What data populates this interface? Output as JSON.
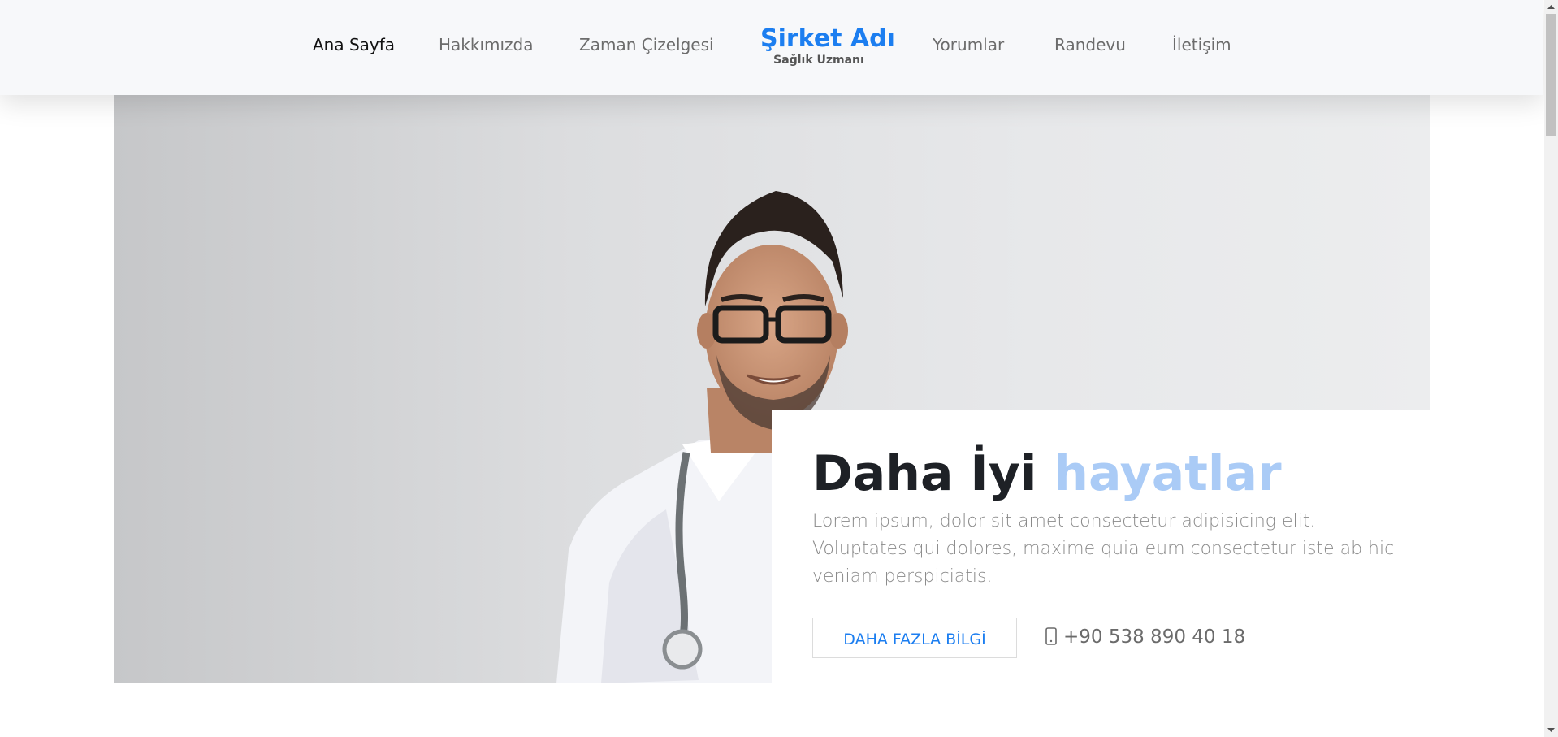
{
  "nav": {
    "items": [
      {
        "label": "Ana Sayfa"
      },
      {
        "label": "Hakkımızda"
      },
      {
        "label": "Zaman Çizelgesi"
      },
      {
        "label": "Yorumlar"
      },
      {
        "label": "Randevu"
      },
      {
        "label": "İletişim"
      }
    ],
    "brand": {
      "title": "Şirket Adı",
      "subtitle": "Sağlık Uzmanı"
    }
  },
  "hero": {
    "title_part1": "Daha İyi",
    "title_highlight": "hayatlar",
    "description": "Lorem ipsum, dolor sit amet consectetur adipisicing elit. Voluptates qui dolores, maxime quia eum consectetur iste ab hic veniam perspiciatis.",
    "cta_label": "DAHA FAZLA BİLGİ",
    "phone_icon": "mobile-phone-icon",
    "phone": "+90 538 890 40 18"
  },
  "colors": {
    "brand": "#1c7ef0",
    "highlight": "#aacbf6",
    "title": "#1e2126",
    "muted": "#8a8a8a"
  }
}
